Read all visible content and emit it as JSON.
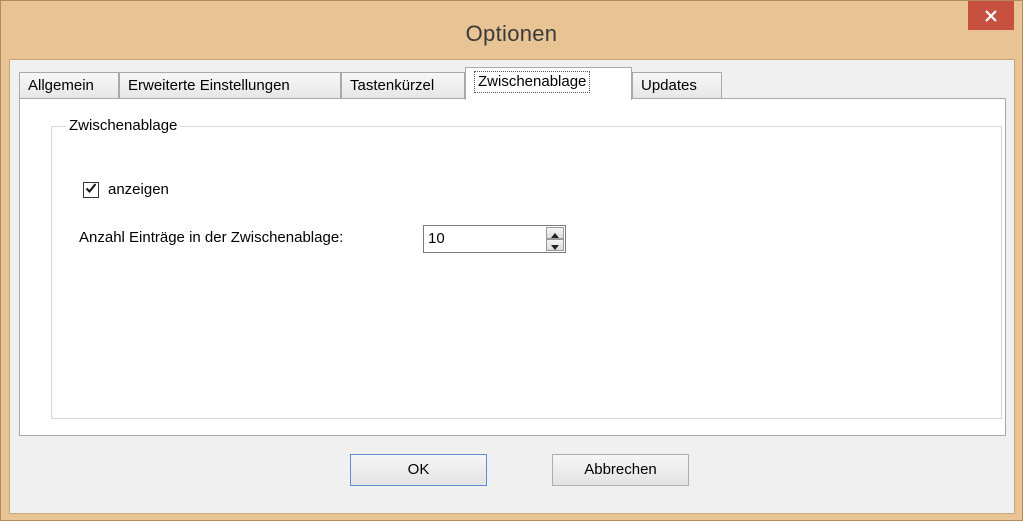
{
  "window": {
    "title": "Optionen",
    "close_icon": "close-icon",
    "frame_color": "#e8c394",
    "close_color": "#c7503f"
  },
  "tabs": [
    {
      "label": "Allgemein",
      "active": false
    },
    {
      "label": "Erweiterte Einstellungen",
      "active": false
    },
    {
      "label": "Tastenkürzel",
      "active": false
    },
    {
      "label": "Zwischenablage",
      "active": true
    },
    {
      "label": "Updates",
      "active": false
    }
  ],
  "clipboard_group": {
    "legend": "Zwischenablage",
    "show_checkbox": {
      "label": "anzeigen",
      "checked": true
    },
    "entry_count": {
      "label": "Anzahl Einträge in der Zwischenablage:",
      "value": "10"
    }
  },
  "buttons": {
    "ok_label": "OK",
    "cancel_label": "Abbrechen"
  }
}
